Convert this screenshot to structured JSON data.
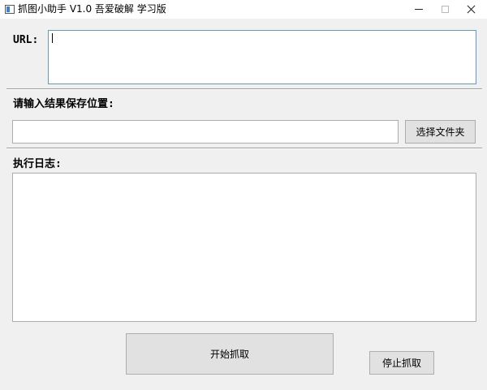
{
  "window": {
    "title": "抓图小助手 V1.0 吾爱破解 学习版",
    "controls": {
      "minimize": "minimize-icon",
      "maximize": "maximize-icon",
      "close": "close-icon"
    }
  },
  "url": {
    "label": "URL:",
    "value": ""
  },
  "save_location": {
    "label": "请输入结果保存位置:",
    "value": "",
    "choose_button": "选择文件夹"
  },
  "log": {
    "label": "执行日志:",
    "content": ""
  },
  "actions": {
    "start_button": "开始抓取",
    "stop_button": "停止抓取"
  },
  "colors": {
    "window_bg": "#f0f0f0",
    "titlebar_bg": "#ffffff",
    "focus_border": "#5b9bd5",
    "button_bg": "#e1e1e1"
  }
}
